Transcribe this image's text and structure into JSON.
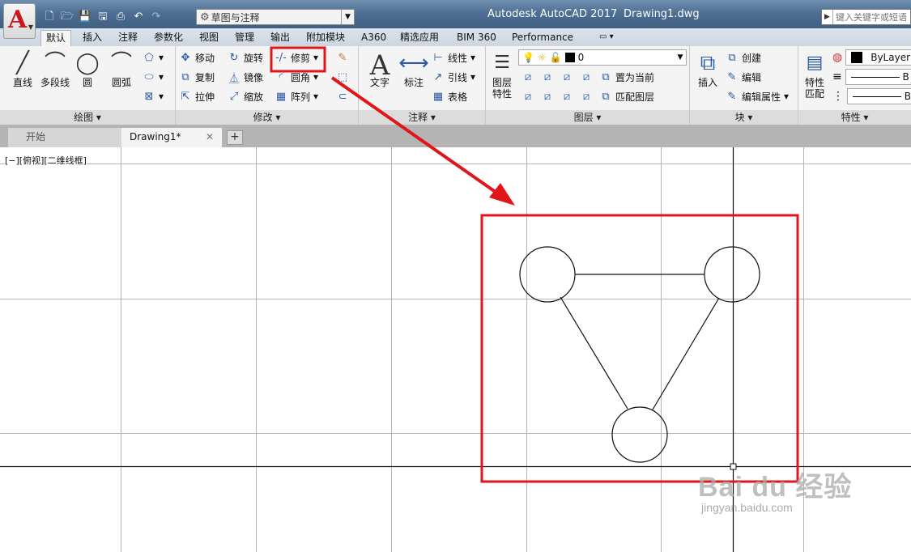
{
  "titlebar": {
    "app_name": "Autodesk AutoCAD 2017",
    "file_name": "Drawing1.dwg",
    "workspace": "草图与注释",
    "search_placeholder": "键入关键字或短语"
  },
  "ribbon_tabs": [
    "默认",
    "插入",
    "注释",
    "参数化",
    "视图",
    "管理",
    "输出",
    "附加模块",
    "A360",
    "精选应用",
    "BIM 360",
    "Performance"
  ],
  "panels": {
    "draw": {
      "title": "绘图",
      "line": "直线",
      "polyline": "多段线",
      "circle": "圆",
      "arc": "圆弧"
    },
    "modify": {
      "title": "修改",
      "move": "移动",
      "rotate": "旋转",
      "trim": "修剪",
      "copy": "复制",
      "mirror": "镜像",
      "fillet": "圆角",
      "stretch": "拉伸",
      "scale": "缩放",
      "array": "阵列"
    },
    "annotation": {
      "title": "注释",
      "text": "文字",
      "dimension": "标注",
      "linear": "线性",
      "leader": "引线",
      "table": "表格"
    },
    "layers": {
      "title": "图层",
      "layer_properties_1": "图层",
      "layer_properties_2": "特性",
      "current_layer": "0",
      "set_current": "置为当前",
      "match_layer": "匹配图层"
    },
    "block": {
      "title": "块",
      "insert": "插入",
      "create": "创建",
      "edit": "编辑",
      "edit_attributes": "编辑属性"
    },
    "properties": {
      "title": "特性",
      "match_1": "特性",
      "match_2": "匹配",
      "color_value": "ByLayer",
      "linetype_value": "B",
      "lineweight_value": "B"
    }
  },
  "file_tabs": {
    "start": "开始",
    "drawing": "Drawing1*"
  },
  "viewport_label": "[−][俯视][二维线框]",
  "watermark": {
    "logo": "Bai du 经验",
    "url": "jingyan.baidu.com"
  },
  "colors": {
    "highlight": "#e0161b",
    "accent_red": "#c8161d"
  }
}
